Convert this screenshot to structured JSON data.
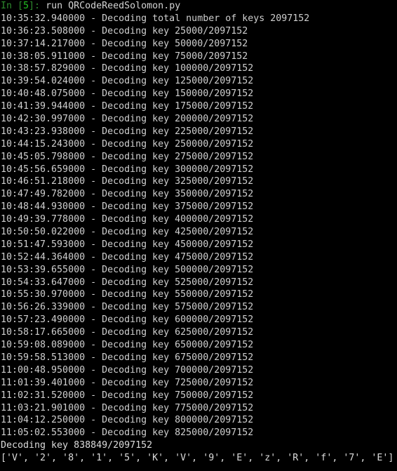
{
  "terminal": {
    "app": "ipython-console",
    "background_color": "#000000",
    "text_color": "#cfcfcf",
    "prompt_color": "#22c122",
    "prompt": {
      "label_open": "In [",
      "label_close": "]:",
      "execution_count": "5",
      "command": "run QRCodeReedSolomon.py"
    },
    "log_lines": [
      "10:35:32.940000 - Decoding total number of keys 2097152",
      "10:36:23.508000 - Decoding key 25000/2097152",
      "10:37:14.217000 - Decoding key 50000/2097152",
      "10:38:05.911000 - Decoding key 75000/2097152",
      "10:38:57.829000 - Decoding key 100000/2097152",
      "10:39:54.024000 - Decoding key 125000/2097152",
      "10:40:48.075000 - Decoding key 150000/2097152",
      "10:41:39.944000 - Decoding key 175000/2097152",
      "10:42:30.997000 - Decoding key 200000/2097152",
      "10:43:23.938000 - Decoding key 225000/2097152",
      "10:44:15.243000 - Decoding key 250000/2097152",
      "10:45:05.798000 - Decoding key 275000/2097152",
      "10:45:56.659000 - Decoding key 300000/2097152",
      "10:46:51.218000 - Decoding key 325000/2097152",
      "10:47:49.782000 - Decoding key 350000/2097152",
      "10:48:44.930000 - Decoding key 375000/2097152",
      "10:49:39.778000 - Decoding key 400000/2097152",
      "10:50:50.022000 - Decoding key 425000/2097152",
      "10:51:47.593000 - Decoding key 450000/2097152",
      "10:52:44.364000 - Decoding key 475000/2097152",
      "10:53:39.655000 - Decoding key 500000/2097152",
      "10:54:33.647000 - Decoding key 525000/2097152",
      "10:55:30.970000 - Decoding key 550000/2097152",
      "10:56:26.339000 - Decoding key 575000/2097152",
      "10:57:23.490000 - Decoding key 600000/2097152",
      "10:58:17.665000 - Decoding key 625000/2097152",
      "10:59:08.089000 - Decoding key 650000/2097152",
      "10:59:58.513000 - Decoding key 675000/2097152",
      "11:00:48.950000 - Decoding key 700000/2097152",
      "11:01:39.401000 - Decoding key 725000/2097152",
      "11:02:31.520000 - Decoding key 750000/2097152",
      "11:03:21.901000 - Decoding key 775000/2097152",
      "11:04:12.250000 - Decoding key 800000/2097152",
      "11:05:02.553000 - Decoding key 825000/2097152"
    ],
    "status_line": "Decoding key 838849/2097152",
    "result_line": "['V', '2', '8', '1', '5', 'K', 'V', '9', 'E', 'z', 'R', 'f', '7', 'E']"
  }
}
